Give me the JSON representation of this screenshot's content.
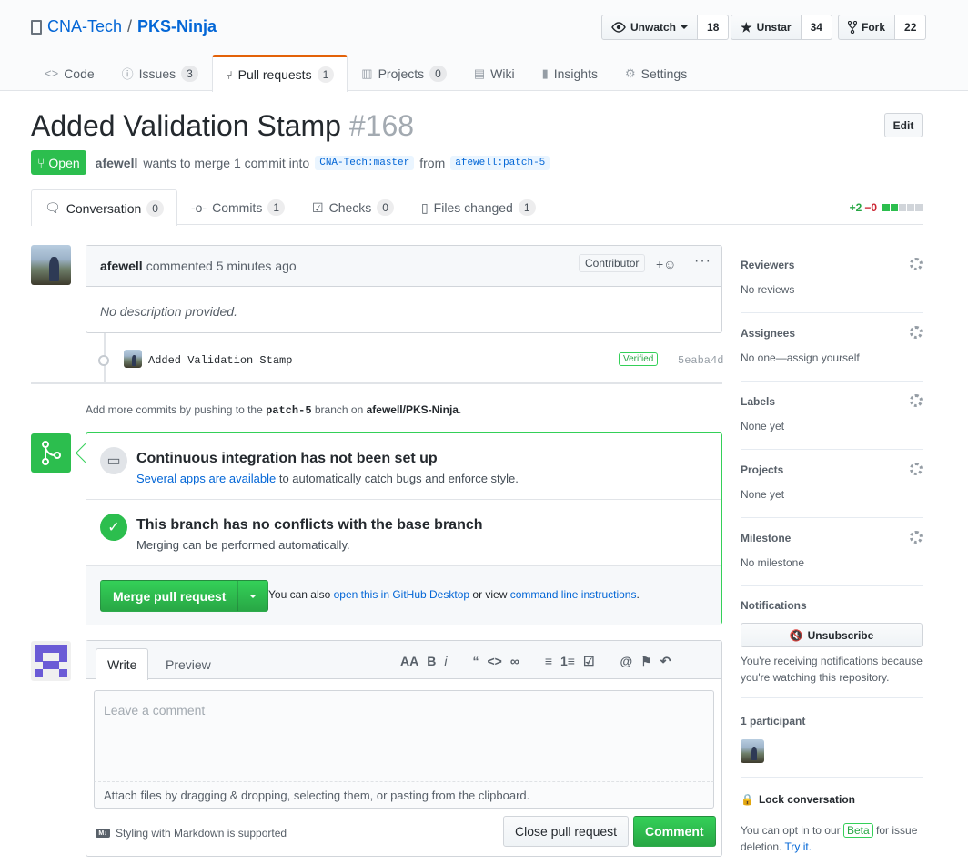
{
  "repo": {
    "owner": "CNA-Tech",
    "separator": "/",
    "name": "PKS-Ninja"
  },
  "actions": {
    "watch": {
      "label": "Unwatch",
      "count": "18"
    },
    "star": {
      "label": "Unstar",
      "count": "34"
    },
    "fork": {
      "label": "Fork",
      "count": "22"
    }
  },
  "reponav": [
    {
      "label": "Code",
      "icon": "code-icon"
    },
    {
      "label": "Issues",
      "count": "3",
      "icon": "issue-icon"
    },
    {
      "label": "Pull requests",
      "count": "1",
      "icon": "pull-request-icon"
    },
    {
      "label": "Projects",
      "count": "0",
      "icon": "project-icon"
    },
    {
      "label": "Wiki",
      "icon": "book-icon"
    },
    {
      "label": "Insights",
      "icon": "graph-icon"
    },
    {
      "label": "Settings",
      "icon": "gear-icon"
    }
  ],
  "pr": {
    "title": "Added Validation Stamp",
    "number": "#168",
    "edit_label": "Edit",
    "state": "Open",
    "author": "afewell",
    "merge_text": "wants to merge 1 commit into",
    "base_branch": "CNA-Tech:master",
    "from_text": "from",
    "head_branch": "afewell:patch-5"
  },
  "tabs": [
    {
      "label": "Conversation",
      "count": "0"
    },
    {
      "label": "Commits",
      "count": "1"
    },
    {
      "label": "Checks",
      "count": "0"
    },
    {
      "label": "Files changed",
      "count": "1"
    }
  ],
  "diffstat": {
    "additions": "+2",
    "deletions": "−0",
    "blocks": [
      "green",
      "green",
      "grey",
      "grey",
      "grey"
    ]
  },
  "colors": {
    "green": "#2cbe4e",
    "grey": "#d1d5da",
    "link": "#0366d6",
    "accent": "#e36209"
  },
  "comment": {
    "author": "afewell",
    "action": "commented 5 minutes ago",
    "badge": "Contributor",
    "body": "No description provided."
  },
  "commit": {
    "message": "Added Validation Stamp",
    "verified": "Verified",
    "sha": "5eaba4d"
  },
  "push_hint": {
    "prefix": "Add more commits by pushing to the",
    "branch": "patch-5",
    "middle": "branch on",
    "repo": "afewell/PKS-Ninja",
    "suffix": "."
  },
  "merge": {
    "ci_title": "Continuous integration has not been set up",
    "ci_link": "Several apps are available",
    "ci_text": "to automatically catch bugs and enforce style.",
    "conflict_title": "This branch has no conflicts with the base branch",
    "conflict_text": "Merging can be performed automatically.",
    "merge_button": "Merge pull request",
    "alt_prefix": "You can also",
    "alt_link1": "open this in GitHub Desktop",
    "alt_middle": "or view",
    "alt_link2": "command line instructions",
    "alt_suffix": "."
  },
  "editor": {
    "write_tab": "Write",
    "preview_tab": "Preview",
    "toolbar": [
      "AA",
      "B",
      "i",
      "“",
      "<>",
      "∞",
      "≡",
      "1≡",
      "☑",
      "@",
      "⚑",
      "↶"
    ],
    "placeholder": "Leave a comment",
    "attach_text": "Attach files by dragging & dropping, selecting them, or pasting from the clipboard.",
    "markdown_hint": "Styling with Markdown is supported",
    "close_button": "Close pull request",
    "comment_button": "Comment"
  },
  "sidebar": {
    "items": [
      {
        "label": "Reviewers",
        "value": "No reviews"
      },
      {
        "label": "Assignees",
        "value": "No one—assign yourself"
      },
      {
        "label": "Labels",
        "value": "None yet"
      },
      {
        "label": "Projects",
        "value": "None yet"
      },
      {
        "label": "Milestone",
        "value": "No milestone"
      }
    ],
    "notifications_label": "Notifications",
    "unsubscribe": "Unsubscribe",
    "notif_reason": "You're receiving notifications because you're watching this repository.",
    "participants": "1 participant",
    "lock_label": "Lock conversation",
    "lock_prefix": "You can opt in to our",
    "beta": "Beta",
    "lock_middle": "for issue deletion.",
    "try_it": "Try it."
  }
}
